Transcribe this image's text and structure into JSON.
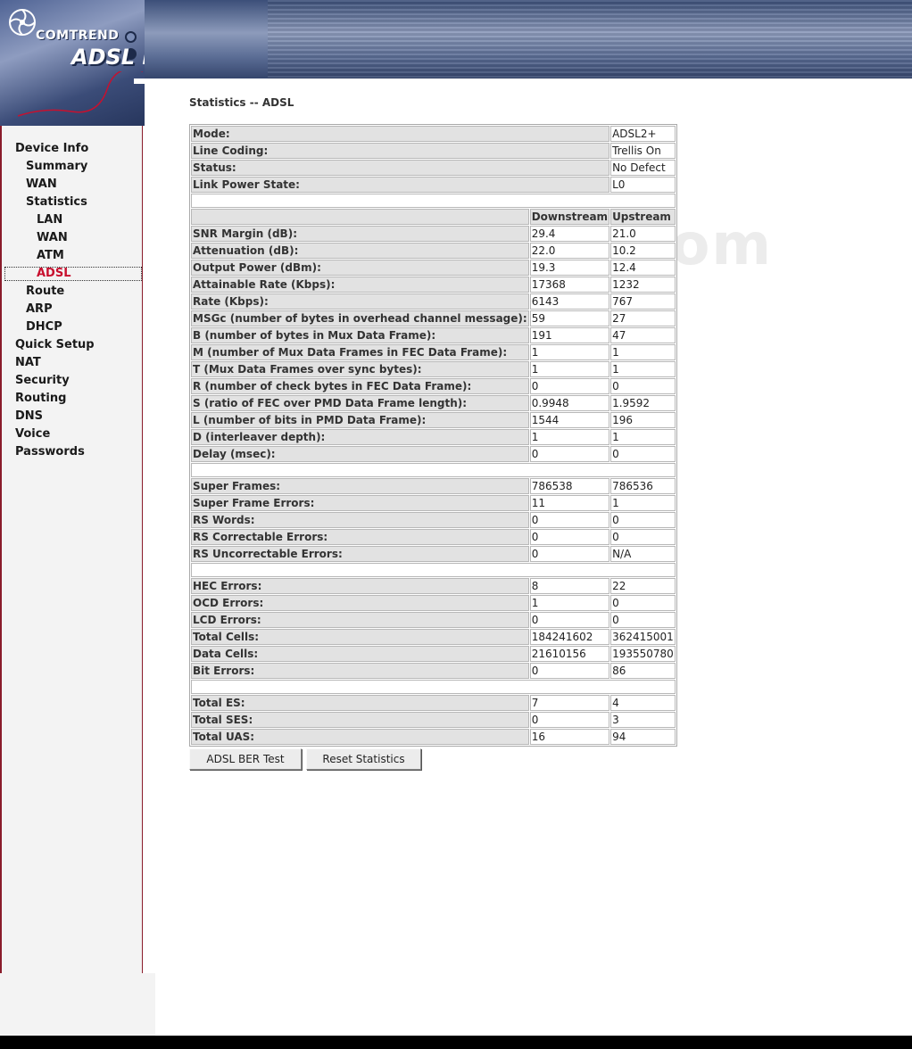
{
  "brand": {
    "company": "COMTREND",
    "product": "ADSL Router"
  },
  "watermark": "DSLWinTech.com",
  "sidebar": {
    "items": [
      {
        "label": "Device Info",
        "level": 1
      },
      {
        "label": "Summary",
        "level": 2
      },
      {
        "label": "WAN",
        "level": 2
      },
      {
        "label": "Statistics",
        "level": 2
      },
      {
        "label": "LAN",
        "level": 3
      },
      {
        "label": "WAN",
        "level": 3
      },
      {
        "label": "ATM",
        "level": 3
      },
      {
        "label": "ADSL",
        "level": 3,
        "active": true
      },
      {
        "label": "Route",
        "level": 2
      },
      {
        "label": "ARP",
        "level": 2
      },
      {
        "label": "DHCP",
        "level": 2
      },
      {
        "label": "Quick Setup",
        "level": 1
      },
      {
        "label": "NAT",
        "level": 1
      },
      {
        "label": "Security",
        "level": 1
      },
      {
        "label": "Routing",
        "level": 1
      },
      {
        "label": "DNS",
        "level": 1
      },
      {
        "label": "Voice",
        "level": 1
      },
      {
        "label": "Passwords",
        "level": 1
      }
    ]
  },
  "page_title": "Statistics -- ADSL",
  "table": {
    "top": [
      {
        "label": "Mode:",
        "value": "ADSL2+"
      },
      {
        "label": "Line Coding:",
        "value": "Trellis On"
      },
      {
        "label": "Status:",
        "value": "No Defect"
      },
      {
        "label": "Link Power State:",
        "value": "L0"
      }
    ],
    "headers": {
      "downstream": "Downstream",
      "upstream": "Upstream"
    },
    "sections": [
      [
        {
          "label": "SNR Margin (dB):",
          "down": "29.4",
          "up": "21.0"
        },
        {
          "label": "Attenuation (dB):",
          "down": "22.0",
          "up": "10.2"
        },
        {
          "label": "Output Power (dBm):",
          "down": "19.3",
          "up": "12.4"
        },
        {
          "label": "Attainable Rate (Kbps):",
          "down": "17368",
          "up": "1232"
        },
        {
          "label": "Rate (Kbps):",
          "down": "6143",
          "up": "767"
        },
        {
          "label": "MSGc (number of bytes in overhead channel message):",
          "down": "59",
          "up": "27"
        },
        {
          "label": "B (number of bytes in Mux Data Frame):",
          "down": "191",
          "up": "47"
        },
        {
          "label": "M (number of Mux Data Frames in FEC Data Frame):",
          "down": "1",
          "up": "1"
        },
        {
          "label": "T (Mux Data Frames over sync bytes):",
          "down": "1",
          "up": "1"
        },
        {
          "label": "R (number of check bytes in FEC Data Frame):",
          "down": "0",
          "up": "0"
        },
        {
          "label": "S (ratio of FEC over PMD Data Frame length):",
          "down": "0.9948",
          "up": "1.9592"
        },
        {
          "label": "L (number of bits in PMD Data Frame):",
          "down": "1544",
          "up": "196"
        },
        {
          "label": "D (interleaver depth):",
          "down": "1",
          "up": "1"
        },
        {
          "label": "Delay (msec):",
          "down": "0",
          "up": "0"
        }
      ],
      [
        {
          "label": "Super Frames:",
          "down": "786538",
          "up": "786536"
        },
        {
          "label": "Super Frame Errors:",
          "down": "11",
          "up": "1"
        },
        {
          "label": "RS Words:",
          "down": "0",
          "up": "0"
        },
        {
          "label": "RS Correctable Errors:",
          "down": "0",
          "up": "0"
        },
        {
          "label": "RS Uncorrectable Errors:",
          "down": "0",
          "up": "N/A"
        }
      ],
      [
        {
          "label": "HEC Errors:",
          "down": "8",
          "up": "22"
        },
        {
          "label": "OCD Errors:",
          "down": "1",
          "up": "0"
        },
        {
          "label": "LCD Errors:",
          "down": "0",
          "up": "0"
        },
        {
          "label": "Total Cells:",
          "down": "184241602",
          "up": "362415001"
        },
        {
          "label": "Data Cells:",
          "down": "21610156",
          "up": "193550780"
        },
        {
          "label": "Bit Errors:",
          "down": "0",
          "up": "86"
        }
      ],
      [
        {
          "label": "Total ES:",
          "down": "7",
          "up": "4"
        },
        {
          "label": "Total SES:",
          "down": "0",
          "up": "3"
        },
        {
          "label": "Total UAS:",
          "down": "16",
          "up": "94"
        }
      ]
    ]
  },
  "buttons": {
    "ber_test": "ADSL BER Test",
    "reset": "Reset Statistics"
  },
  "colors": {
    "accent": "#c8102e",
    "sidebar_border": "#8a1c2b",
    "banner": "#3c4f79"
  }
}
